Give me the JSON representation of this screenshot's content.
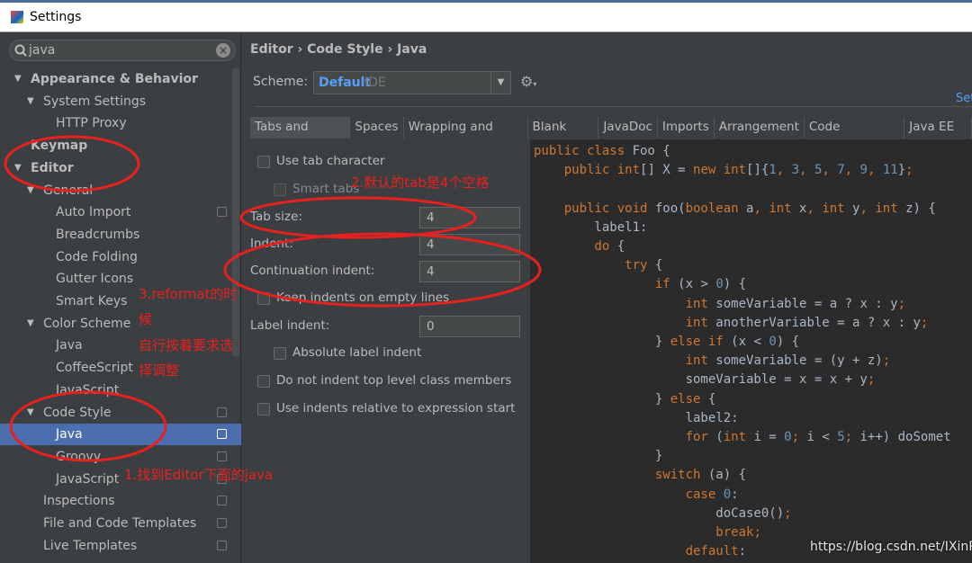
{
  "window": {
    "title": "Settings"
  },
  "search": {
    "value": "java"
  },
  "tree": [
    {
      "label": "Appearance & Behavior",
      "level": 0,
      "arrow": true,
      "bold": true
    },
    {
      "label": "System Settings",
      "level": 1,
      "arrow": true
    },
    {
      "label": "HTTP Proxy",
      "level": 2
    },
    {
      "label": "Keymap",
      "level": 0,
      "bold": true
    },
    {
      "label": "Editor",
      "level": 0,
      "arrow": true,
      "bold": true
    },
    {
      "label": "General",
      "level": 1,
      "arrow": true
    },
    {
      "label": "Auto Import",
      "level": 2,
      "copy": true
    },
    {
      "label": "Breadcrumbs",
      "level": 2
    },
    {
      "label": "Code Folding",
      "level": 2
    },
    {
      "label": "Gutter Icons",
      "level": 2
    },
    {
      "label": "Smart Keys",
      "level": 2
    },
    {
      "label": "Color Scheme",
      "level": 1,
      "arrow": true
    },
    {
      "label": "Java",
      "level": 2
    },
    {
      "label": "CoffeeScript",
      "level": 2
    },
    {
      "label": "JavaScript",
      "level": 2
    },
    {
      "label": "Code Style",
      "level": 1,
      "arrow": true,
      "copy": true
    },
    {
      "label": "Java",
      "level": 2,
      "copy": true,
      "selected": true
    },
    {
      "label": "Groovy",
      "level": 2,
      "copy": true
    },
    {
      "label": "JavaScript",
      "level": 2,
      "copy": true
    },
    {
      "label": "Inspections",
      "level": 1,
      "copy": true
    },
    {
      "label": "File and Code Templates",
      "level": 1,
      "copy": true
    },
    {
      "label": "Live Templates",
      "level": 1,
      "copy": true
    }
  ],
  "header": {
    "breadcrumb": "Editor › Code Style › Java",
    "scheme_label": "Scheme:",
    "scheme_name": "Default",
    "scheme_type": "IDE",
    "set_from_link": "Set"
  },
  "tabs": [
    "Tabs and Indents",
    "Spaces",
    "Wrapping and Braces",
    "Blank Lines",
    "JavaDoc",
    "Imports",
    "Arrangement",
    "Code Generation",
    "Java EE Na"
  ],
  "options": {
    "use_tab_character": "Use tab character",
    "smart_tabs": "Smart tabs",
    "tab_size_label": "Tab size:",
    "tab_size": "4",
    "indent_label": "Indent:",
    "indent": "4",
    "continuation_indent_label": "Continuation indent:",
    "continuation_indent": "4",
    "keep_indents": "Keep indents on empty lines",
    "label_indent_label": "Label indent:",
    "label_indent": "0",
    "absolute_label_indent": "Absolute label indent",
    "no_indent_top_level": "Do not indent top level class members",
    "use_relative_indents": "Use indents relative to expression start"
  },
  "code": [
    [
      [
        "public class ",
        "k"
      ],
      [
        "Foo {",
        "t"
      ]
    ],
    [
      [
        "    public int",
        "k"
      ],
      [
        "[] X = ",
        "t"
      ],
      [
        "new int",
        "k"
      ],
      [
        "[]{",
        "t"
      ],
      [
        "1",
        "n"
      ],
      [
        ", ",
        "k"
      ],
      [
        "3",
        "n"
      ],
      [
        ", ",
        "k"
      ],
      [
        "5",
        "n"
      ],
      [
        ", ",
        "k"
      ],
      [
        "7",
        "n"
      ],
      [
        ", ",
        "k"
      ],
      [
        "9",
        "n"
      ],
      [
        ", ",
        "k"
      ],
      [
        "11",
        "n"
      ],
      [
        "}",
        "t"
      ],
      [
        ";",
        "k"
      ]
    ],
    [],
    [
      [
        "    public void ",
        "k"
      ],
      [
        "foo(",
        "t"
      ],
      [
        "boolean ",
        "k"
      ],
      [
        "a",
        "t"
      ],
      [
        ", ",
        "k"
      ],
      [
        "int ",
        "k"
      ],
      [
        "x",
        "t"
      ],
      [
        ", ",
        "k"
      ],
      [
        "int ",
        "k"
      ],
      [
        "y",
        "t"
      ],
      [
        ", ",
        "k"
      ],
      [
        "int ",
        "k"
      ],
      [
        "z) {",
        "t"
      ]
    ],
    [
      [
        "        label1:",
        "t"
      ]
    ],
    [
      [
        "        do ",
        "k"
      ],
      [
        "{",
        "t"
      ]
    ],
    [
      [
        "            try ",
        "k"
      ],
      [
        "{",
        "t"
      ]
    ],
    [
      [
        "                if ",
        "k"
      ],
      [
        "(x > ",
        "t"
      ],
      [
        "0",
        "n"
      ],
      [
        ") {",
        "t"
      ]
    ],
    [
      [
        "                    int ",
        "k"
      ],
      [
        "someVariable = a ? x : y",
        "t"
      ],
      [
        ";",
        "k"
      ]
    ],
    [
      [
        "                    int ",
        "k"
      ],
      [
        "anotherVariable = a ? x : y",
        "t"
      ],
      [
        ";",
        "k"
      ]
    ],
    [
      [
        "                } ",
        "t"
      ],
      [
        "else if ",
        "k"
      ],
      [
        "(x < ",
        "t"
      ],
      [
        "0",
        "n"
      ],
      [
        ") {",
        "t"
      ]
    ],
    [
      [
        "                    int ",
        "k"
      ],
      [
        "someVariable = (y + z)",
        "t"
      ],
      [
        ";",
        "k"
      ]
    ],
    [
      [
        "                    someVariable = x = x + y",
        "t"
      ],
      [
        ";",
        "k"
      ]
    ],
    [
      [
        "                } ",
        "t"
      ],
      [
        "else ",
        "k"
      ],
      [
        "{",
        "t"
      ]
    ],
    [
      [
        "                    label2:",
        "t"
      ]
    ],
    [
      [
        "                    for ",
        "k"
      ],
      [
        "(",
        "t"
      ],
      [
        "int ",
        "k"
      ],
      [
        "i = ",
        "t"
      ],
      [
        "0",
        "n"
      ],
      [
        "; ",
        "k"
      ],
      [
        "i < ",
        "t"
      ],
      [
        "5",
        "n"
      ],
      [
        "; ",
        "k"
      ],
      [
        "i++) doSomet",
        "t"
      ]
    ],
    [
      [
        "                }",
        "t"
      ]
    ],
    [
      [
        "                switch ",
        "k"
      ],
      [
        "(a) {",
        "t"
      ]
    ],
    [
      [
        "                    case ",
        "k"
      ],
      [
        "0",
        "n"
      ],
      [
        ":",
        "t"
      ]
    ],
    [
      [
        "                        doCase0()",
        "t"
      ],
      [
        ";",
        "k"
      ]
    ],
    [
      [
        "                        break",
        "k"
      ],
      [
        ";",
        "k"
      ]
    ],
    [
      [
        "                    default",
        "k"
      ],
      [
        ":",
        "t"
      ]
    ]
  ],
  "annotations": {
    "note1": "1.找到Editor下面的java",
    "note2": "2.默认的tab是4个空格",
    "note3_line1": "3.reformat的时",
    "note3_line2": "候",
    "note3_line3": "自行按着要求选",
    "note3_line4": "择调整",
    "color": "#e8201f"
  },
  "watermark": "https://blog.csdn.net/IXinRu",
  "colors": {
    "sidebar_bg": "#3c3f41",
    "editor_bg": "#2b2b2b",
    "selection": "#4b6eaf",
    "keyword": "#cc7832",
    "number": "#6897bb",
    "text": "#a9b7c6",
    "link": "#589df6"
  }
}
